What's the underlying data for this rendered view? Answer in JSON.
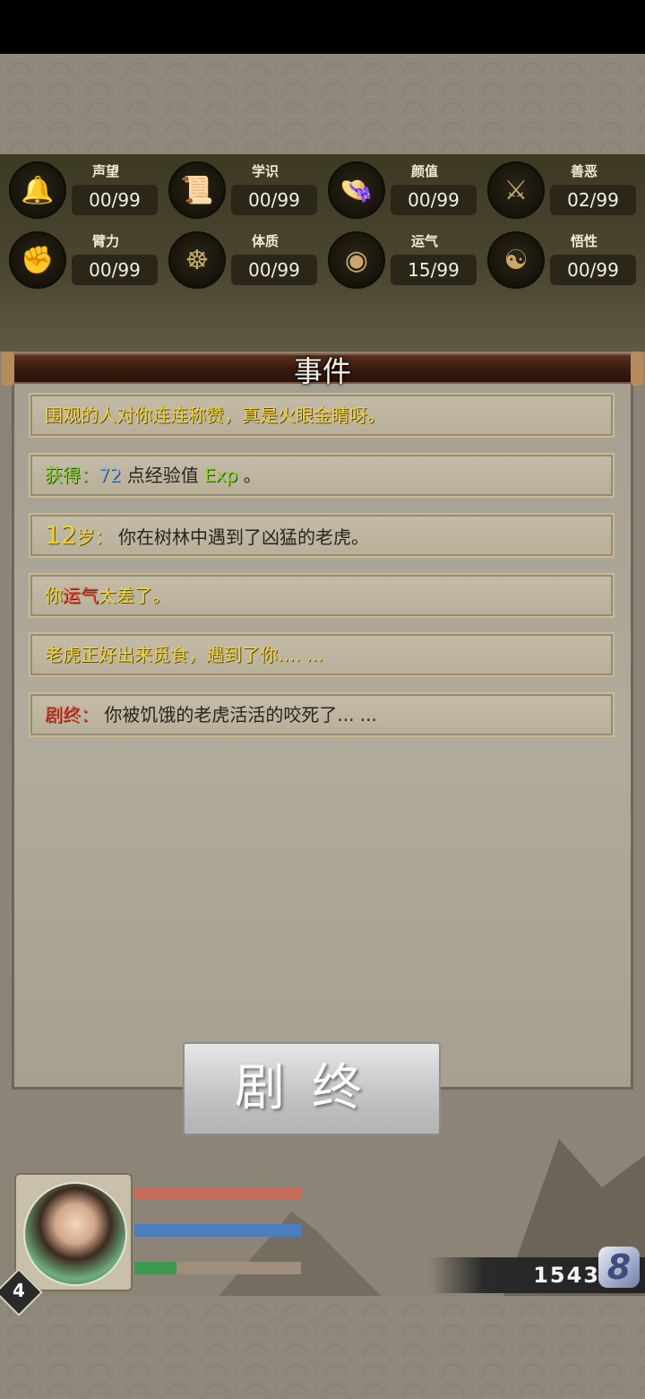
{
  "stats": [
    {
      "name": "声望",
      "value": "00/99",
      "icon": "bell-icon",
      "glyph": "🔔"
    },
    {
      "name": "学识",
      "value": "00/99",
      "icon": "scroll-icon",
      "glyph": "📜"
    },
    {
      "name": "颜值",
      "value": "00/99",
      "icon": "hat-icon",
      "glyph": "👒"
    },
    {
      "name": "善恶",
      "value": "02/99",
      "icon": "swords-icon",
      "glyph": "⚔"
    },
    {
      "name": "臂力",
      "value": "00/99",
      "icon": "fist-icon",
      "glyph": "✊"
    },
    {
      "name": "体质",
      "value": "00/99",
      "icon": "body-icon",
      "glyph": "☸"
    },
    {
      "name": "运气",
      "value": "15/99",
      "icon": "coin-icon",
      "glyph": "◉"
    },
    {
      "name": "悟性",
      "value": "00/99",
      "icon": "head-icon",
      "glyph": "☯"
    }
  ],
  "panel": {
    "title": "事件"
  },
  "events": {
    "e1": "围观的人对你连连称赞，真是火眼金睛呀。",
    "e2_prefix": "获得：",
    "e2_value": "72",
    "e2_mid": " 点经验值 ",
    "e2_exp": "Exp",
    "e2_end": " 。",
    "e3_age": "12",
    "e3_age_unit": "岁：",
    "e3_text": " 你在树林中遇到了凶猛的老虎。",
    "e4_pre": "你",
    "e4_red": "运气",
    "e4_post": "太差了。",
    "e5": "老虎正好出来觅食，遇到了你.... ...",
    "e6_prefix": "剧终：",
    "e6_text": " 你被饥饿的老虎活活的咬死了... ..."
  },
  "end_button": {
    "label": "剧终"
  },
  "player": {
    "level": "4",
    "score": "1543",
    "hp_value": "947",
    "hp_fill": 1.0,
    "mp_fill": 1.0,
    "exp_fill": 0.25,
    "score_icon_glyph": "8",
    "colors": {
      "hp": "#c76a5a",
      "mp": "#4a7fc0",
      "exp": "#3c9a50"
    }
  }
}
